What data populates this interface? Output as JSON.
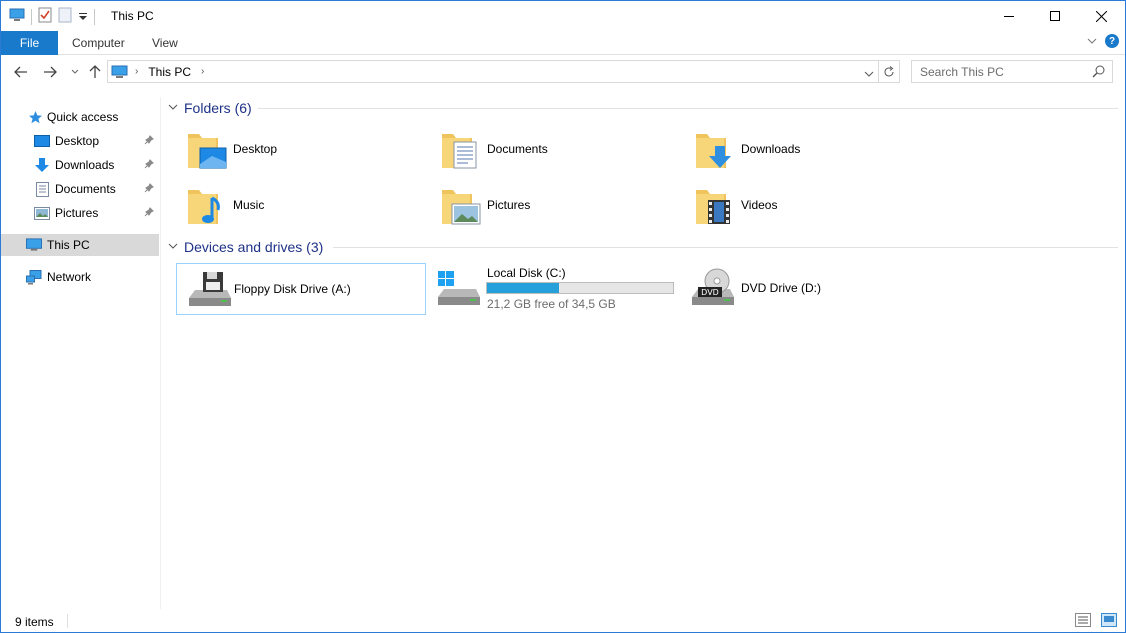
{
  "window": {
    "title": "This PC",
    "accent": "#1979ca"
  },
  "ribbon": {
    "file_label": "File",
    "tabs": [
      {
        "label": "Computer"
      },
      {
        "label": "View"
      }
    ]
  },
  "address": {
    "breadcrumb": "This PC"
  },
  "search": {
    "placeholder": "Search This PC"
  },
  "sidebar": {
    "items": [
      {
        "label": "Quick access",
        "icon": "star-icon"
      },
      {
        "label": "Desktop",
        "icon": "desktop-icon",
        "pinned": true
      },
      {
        "label": "Downloads",
        "icon": "download-arrow-icon",
        "pinned": true
      },
      {
        "label": "Documents",
        "icon": "document-icon",
        "pinned": true
      },
      {
        "label": "Pictures",
        "icon": "picture-icon",
        "pinned": true
      },
      {
        "label": "This PC",
        "icon": "computer-icon",
        "selected": true
      },
      {
        "label": "Network",
        "icon": "network-icon"
      }
    ]
  },
  "folders": {
    "header": "Folders (6)",
    "items": [
      {
        "label": "Desktop",
        "icon": "desktop-folder-icon"
      },
      {
        "label": "Documents",
        "icon": "documents-folder-icon"
      },
      {
        "label": "Downloads",
        "icon": "downloads-folder-icon"
      },
      {
        "label": "Music",
        "icon": "music-folder-icon"
      },
      {
        "label": "Pictures",
        "icon": "pictures-folder-icon"
      },
      {
        "label": "Videos",
        "icon": "videos-folder-icon"
      }
    ]
  },
  "drives": {
    "header": "Devices and drives (3)",
    "items": [
      {
        "label": "Floppy Disk Drive (A:)",
        "icon": "floppy-drive-icon"
      },
      {
        "label": "Local Disk (C:)",
        "icon": "local-disk-icon",
        "free_text": "21,2 GB free of 34,5 GB",
        "used_fraction": 0.386
      },
      {
        "label": "DVD Drive (D:)",
        "icon": "dvd-drive-icon"
      }
    ]
  },
  "status": {
    "items_count": "9 items"
  }
}
